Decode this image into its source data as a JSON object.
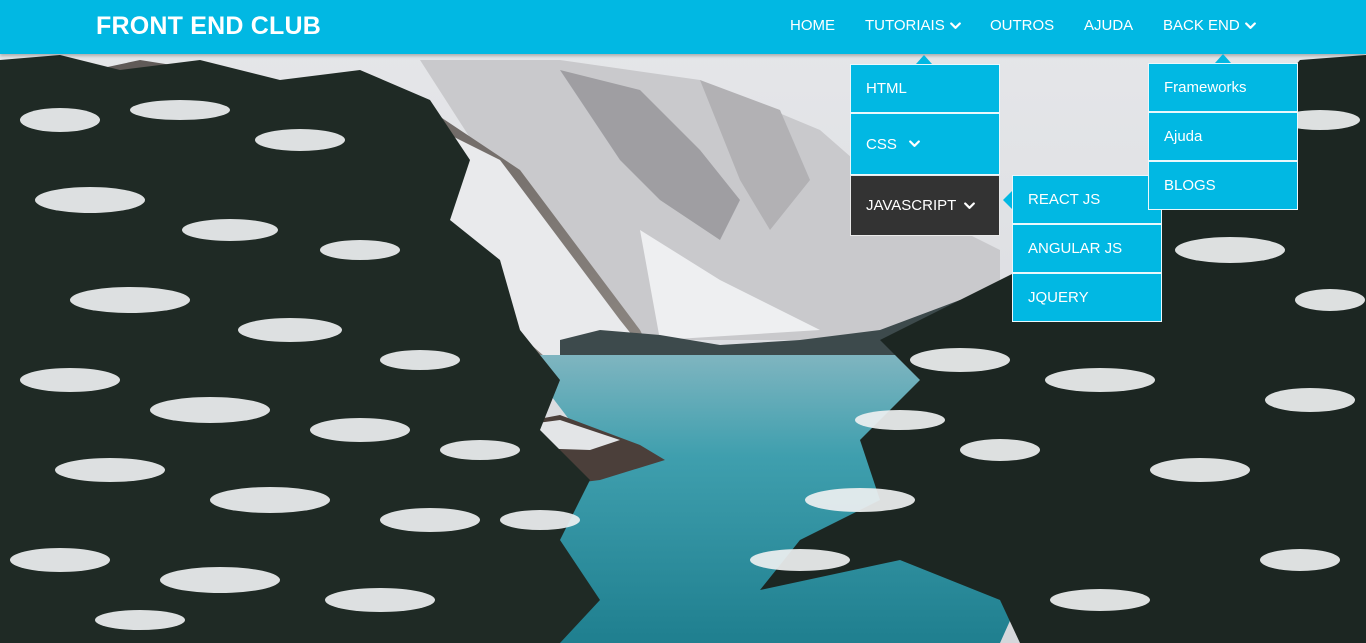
{
  "brand": {
    "title": "FRONT END CLUB"
  },
  "nav": {
    "home": "HOME",
    "tutoriais": "TUTORIAIS",
    "outros": "OUTROS",
    "ajuda": "AJUDA",
    "backend": "BACK END"
  },
  "tutoriais_menu": {
    "html": "HTML",
    "css": "CSS",
    "javascript": "JAVASCRIPT"
  },
  "javascript_menu": {
    "react": "REACT JS",
    "angular": "ANGULAR JS",
    "jquery": "JQUERY"
  },
  "backend_menu": {
    "frameworks": "Frameworks",
    "ajuda": "Ajuda",
    "blogs": "BLOGS"
  },
  "colors": {
    "navbar": "#01b8e3",
    "active_item": "#333333",
    "text": "#ffffff"
  },
  "icons": {
    "dropdown_indicator": "chevron-down-icon",
    "submenu_pointer": "caret-icon"
  }
}
